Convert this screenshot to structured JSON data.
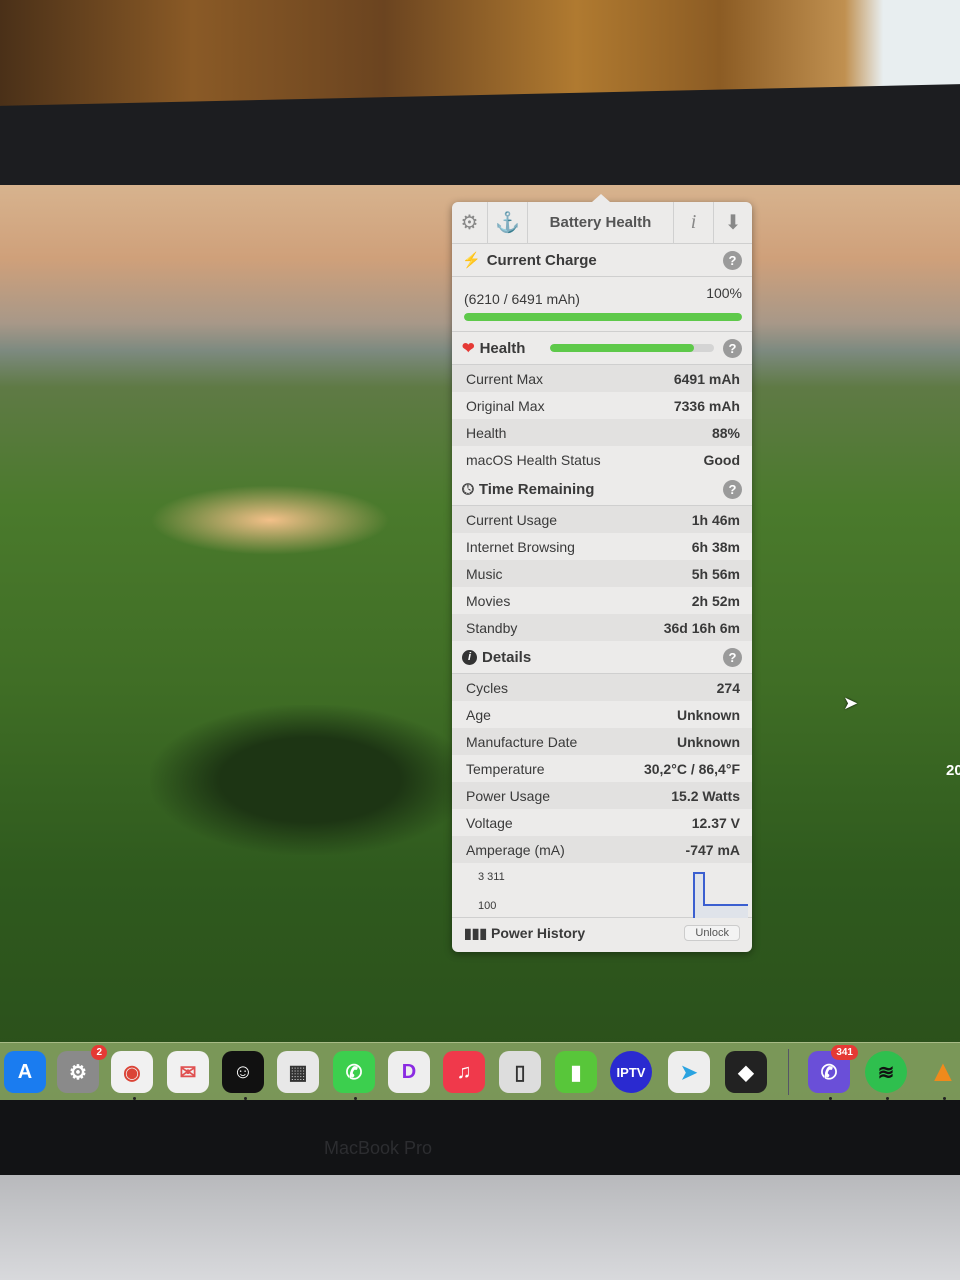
{
  "window": {
    "title": "Battery Health"
  },
  "toolbar": {
    "settings_icon": "gear-icon",
    "anchor_icon": "anchor-icon",
    "info_icon": "i",
    "download_icon": "arrow-down-icon"
  },
  "current_charge": {
    "title": "Current Charge",
    "mah": "(6210 / 6491 mAh)",
    "percent": "100%",
    "fill": 1.0
  },
  "health": {
    "title": "Health",
    "fill": 0.88,
    "rows": [
      {
        "label": "Current Max",
        "value": "6491 mAh"
      },
      {
        "label": "Original Max",
        "value": "7336 mAh"
      },
      {
        "label": "Health",
        "value": "88%"
      },
      {
        "label": "macOS Health Status",
        "value": "Good"
      }
    ]
  },
  "time_remaining": {
    "title": "Time Remaining",
    "rows": [
      {
        "label": "Current Usage",
        "value": "1h 46m"
      },
      {
        "label": "Internet Browsing",
        "value": "6h 38m"
      },
      {
        "label": "Music",
        "value": "5h 56m"
      },
      {
        "label": "Movies",
        "value": "2h 52m"
      },
      {
        "label": "Standby",
        "value": "36d 16h 6m"
      }
    ]
  },
  "details": {
    "title": "Details",
    "rows": [
      {
        "label": "Cycles",
        "value": "274"
      },
      {
        "label": "Age",
        "value": "Unknown"
      },
      {
        "label": "Manufacture Date",
        "value": "Unknown"
      },
      {
        "label": "Temperature",
        "value": "30,2°C / 86,4°F"
      },
      {
        "label": "Power Usage",
        "value": "15.2 Watts"
      },
      {
        "label": "Voltage",
        "value": "12.37 V"
      },
      {
        "label": "Amperage (mA)",
        "value": "-747 mA"
      }
    ]
  },
  "graph": {
    "max_label": "3 311",
    "min_label": "100"
  },
  "footer": {
    "title": "Power History",
    "unlock": "Unlock"
  },
  "help": "?",
  "dock": {
    "system_settings_badge": "2",
    "viber_badge": "341",
    "iptv_label": "IPTV"
  },
  "laptop_label": "MacBook Pro",
  "edge_text": "20"
}
